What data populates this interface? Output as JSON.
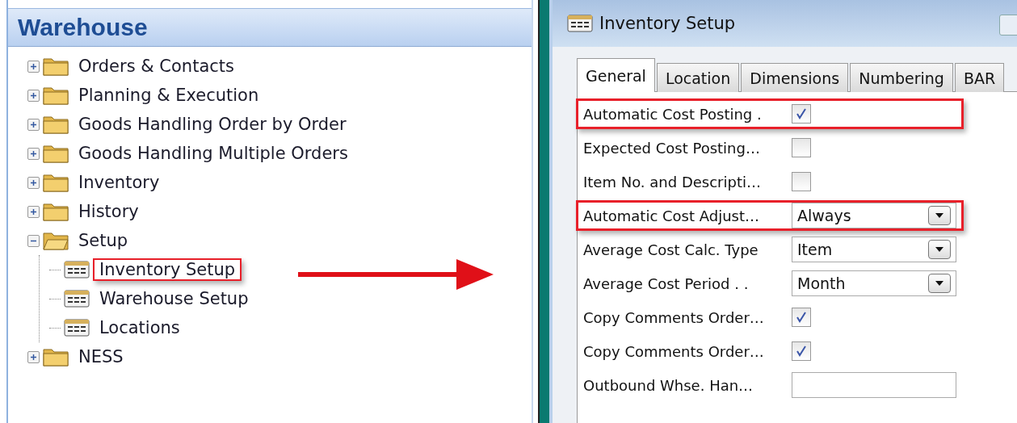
{
  "navigation_pane": {
    "title": "Warehouse",
    "items": [
      {
        "label": "Orders & Contacts",
        "kind": "folder",
        "expanded": false,
        "highlighted": false
      },
      {
        "label": "Planning & Execution",
        "kind": "folder",
        "expanded": false,
        "highlighted": false
      },
      {
        "label": "Goods Handling Order by Order",
        "kind": "folder",
        "expanded": false,
        "highlighted": false
      },
      {
        "label": "Goods Handling Multiple Orders",
        "kind": "folder",
        "expanded": false,
        "highlighted": false
      },
      {
        "label": "Inventory",
        "kind": "folder",
        "expanded": false,
        "highlighted": false
      },
      {
        "label": "History",
        "kind": "folder",
        "expanded": false,
        "highlighted": false
      },
      {
        "label": "Setup",
        "kind": "folder",
        "expanded": true,
        "highlighted": false,
        "children": [
          {
            "label": "Inventory Setup",
            "kind": "form",
            "highlighted": true
          },
          {
            "label": "Warehouse Setup",
            "kind": "form",
            "highlighted": false
          },
          {
            "label": "Locations",
            "kind": "form",
            "highlighted": false
          }
        ]
      },
      {
        "label": "NESS",
        "kind": "folder",
        "expanded": false,
        "highlighted": false
      }
    ]
  },
  "setup_window": {
    "title": "Inventory Setup",
    "tabs": [
      {
        "label": "General",
        "selected": true
      },
      {
        "label": "Location",
        "selected": false
      },
      {
        "label": "Dimensions",
        "selected": false
      },
      {
        "label": "Numbering",
        "selected": false
      },
      {
        "label": "BAR",
        "selected": false
      }
    ],
    "fields": [
      {
        "label": "Automatic Cost Posting  .",
        "kind": "checkbox",
        "checked": true,
        "highlighted": true
      },
      {
        "label": "Expected Cost Posting…",
        "kind": "checkbox",
        "checked": false,
        "highlighted": false
      },
      {
        "label": "Item No. and Descripti…",
        "kind": "checkbox",
        "checked": false,
        "highlighted": false
      },
      {
        "label": "Automatic Cost Adjust…",
        "kind": "dropdown",
        "value": "Always",
        "highlighted": true
      },
      {
        "label": "Average Cost Calc. Type",
        "kind": "dropdown",
        "value": "Item",
        "highlighted": false
      },
      {
        "label": "Average Cost Period  . .",
        "kind": "dropdown",
        "value": "Month",
        "highlighted": false
      },
      {
        "label": "Copy Comments Order…",
        "kind": "checkbox",
        "checked": true,
        "highlighted": false
      },
      {
        "label": "Copy Comments Order…",
        "kind": "checkbox",
        "checked": true,
        "highlighted": false
      },
      {
        "label": "Outbound Whse. Han…",
        "kind": "text",
        "highlighted": false
      }
    ]
  }
}
